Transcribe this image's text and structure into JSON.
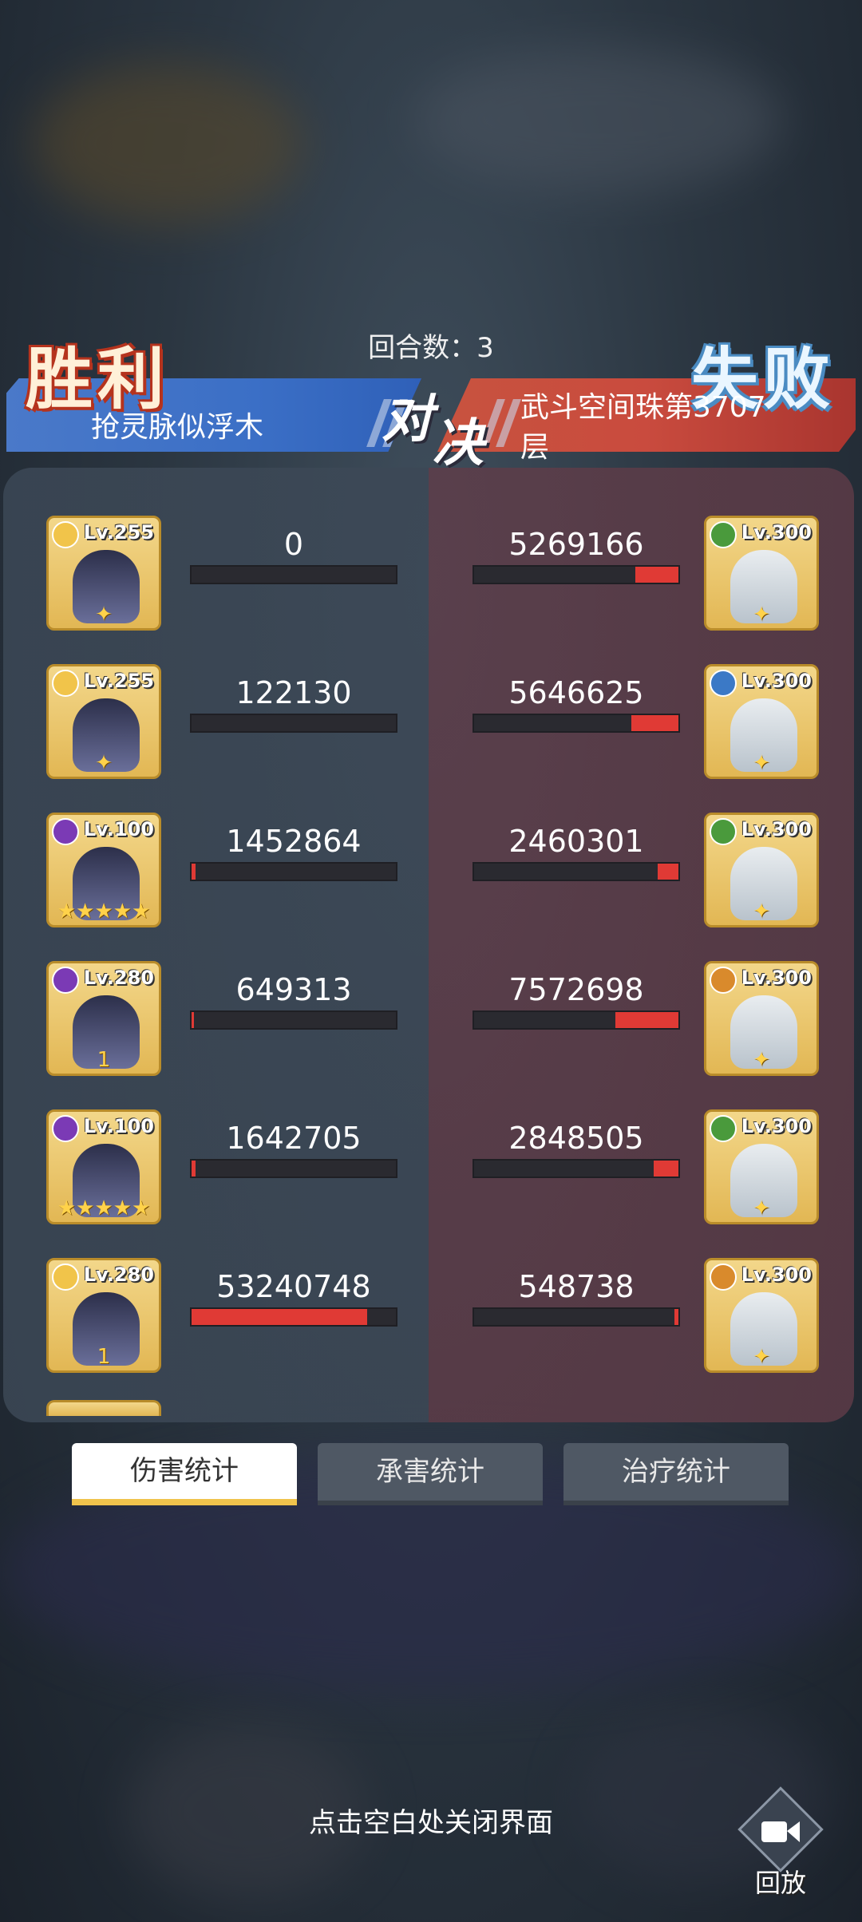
{
  "header": {
    "left_result": "胜利",
    "right_result": "失败",
    "rounds_label": "回合数：3",
    "vs_label_1": "对",
    "vs_label_2": "决",
    "player_left": "抢灵脉似浮木",
    "player_right": "武斗空间珠第3707层"
  },
  "rows": [
    {
      "left": {
        "lv": "Lv.255",
        "value": "0",
        "fill": 0.0,
        "badge_color": "#f1c44a",
        "stars": "✦"
      },
      "right": {
        "lv": "Lv.300",
        "value": "5269166",
        "fill": 0.21,
        "badge_color": "#4a9a3c",
        "stars": "✦"
      }
    },
    {
      "left": {
        "lv": "Lv.255",
        "value": "122130",
        "fill": 0.0,
        "badge_color": "#f1c44a",
        "stars": "✦"
      },
      "right": {
        "lv": "Lv.300",
        "value": "5646625",
        "fill": 0.23,
        "badge_color": "#3b79c6",
        "stars": "✦"
      }
    },
    {
      "left": {
        "lv": "Lv.100",
        "value": "1452864",
        "fill": 0.02,
        "badge_color": "#7b3ab5",
        "stars": "★★★★★"
      },
      "right": {
        "lv": "Lv.300",
        "value": "2460301",
        "fill": 0.1,
        "badge_color": "#4a9a3c",
        "stars": "✦"
      }
    },
    {
      "left": {
        "lv": "Lv.280",
        "value": "649313",
        "fill": 0.01,
        "badge_color": "#7b3ab5",
        "stars": "1"
      },
      "right": {
        "lv": "Lv.300",
        "value": "7572698",
        "fill": 0.31,
        "badge_color": "#d98a2c",
        "stars": "✦"
      }
    },
    {
      "left": {
        "lv": "Lv.100",
        "value": "1642705",
        "fill": 0.02,
        "badge_color": "#7b3ab5",
        "stars": "★★★★★"
      },
      "right": {
        "lv": "Lv.300",
        "value": "2848505",
        "fill": 0.12,
        "badge_color": "#4a9a3c",
        "stars": "✦"
      }
    },
    {
      "left": {
        "lv": "Lv.280",
        "value": "53240748",
        "fill": 0.86,
        "badge_color": "#f1c44a",
        "stars": "1"
      },
      "right": {
        "lv": "Lv.300",
        "value": "548738",
        "fill": 0.02,
        "badge_color": "#d98a2c",
        "stars": "✦"
      }
    }
  ],
  "tabs": [
    {
      "label": "伤害统计",
      "active": true
    },
    {
      "label": "承害统计",
      "active": false
    },
    {
      "label": "治疗统计",
      "active": false
    }
  ],
  "footer": {
    "hint": "点击空白处关闭界面",
    "replay_label": "回放"
  },
  "colors": {
    "bar_fill": "#e03a35",
    "tab_active_underline": "#f0c34c"
  }
}
